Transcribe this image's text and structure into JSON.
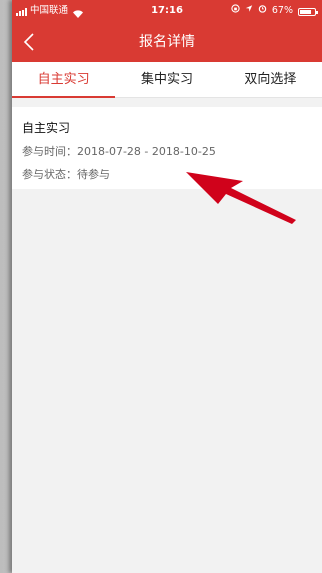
{
  "status_bar": {
    "carrier": "中国联通",
    "time": "17:16",
    "battery_percent": "67%",
    "battery_level": 0.67
  },
  "nav": {
    "title": "报名详情",
    "back_icon": "chevron-left-icon"
  },
  "tabs": [
    {
      "label": "自主实习",
      "active": true
    },
    {
      "label": "集中实习",
      "active": false
    },
    {
      "label": "双向选择",
      "active": false
    }
  ],
  "card": {
    "title": "自主实习",
    "time_line": "参与时间：2018-07-28 - 2018-10-25",
    "status_line": "参与状态：待参与"
  },
  "colors": {
    "accent": "#d93a33",
    "annotation_arrow": "#d0021b"
  }
}
